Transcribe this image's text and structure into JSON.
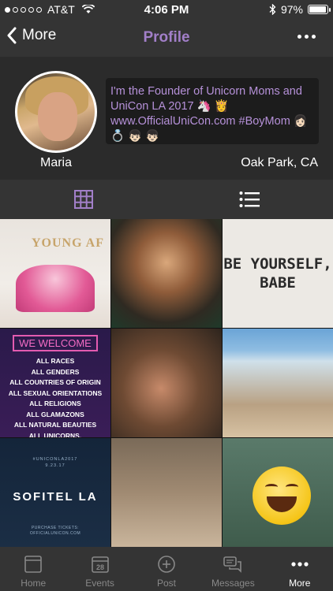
{
  "status_bar": {
    "carrier": "AT&T",
    "time": "4:06 PM",
    "battery": "97%",
    "battery_level": 0.97
  },
  "navbar": {
    "back_label": "More",
    "title": "Profile"
  },
  "profile": {
    "name": "Maria",
    "location": "Oak Park, CA",
    "bio": "I'm the Founder of Unicorn Moms and UniCon LA 2017 🦄 👸 www.OfficialUniCon.com #BoyMom 👩🏻 💍 👦🏻 👦🏻"
  },
  "photos": {
    "p1_text": "YOUNG AF",
    "p3_text": "BE YOURSELF, BABE",
    "p4": {
      "heading": "WE WELCOME",
      "lines": [
        "ALL RACES",
        "ALL GENDERS",
        "ALL COUNTRIES OF ORIGIN",
        "ALL SEXUAL ORIENTATIONS",
        "ALL RELIGIONS",
        "ALL GLAMAZONS",
        "ALL NATURAL BEAUTIES",
        "ALL UNICORNS."
      ]
    },
    "p7": {
      "hashtag": "#UNICONLA2017",
      "date": "9.23.17",
      "title": "SOFITEL LA",
      "footer_1": "PURCHASE TICKETS:",
      "footer_2": "OFFICIALUNICON.COM"
    }
  },
  "tabbar": {
    "tabs": [
      {
        "label": "Home",
        "icon": "home-icon"
      },
      {
        "label": "Events",
        "icon": "calendar-icon",
        "badge_text": "28"
      },
      {
        "label": "Post",
        "icon": "plus-circle-icon"
      },
      {
        "label": "Messages",
        "icon": "chat-icon"
      },
      {
        "label": "More",
        "icon": "more-dots-icon"
      }
    ],
    "active_index": 4
  },
  "colors": {
    "accent_purple": "#a27fc9",
    "bio_text": "#b691d9",
    "bar_bg": "#343434",
    "page_bg": "#2b2b2b"
  }
}
